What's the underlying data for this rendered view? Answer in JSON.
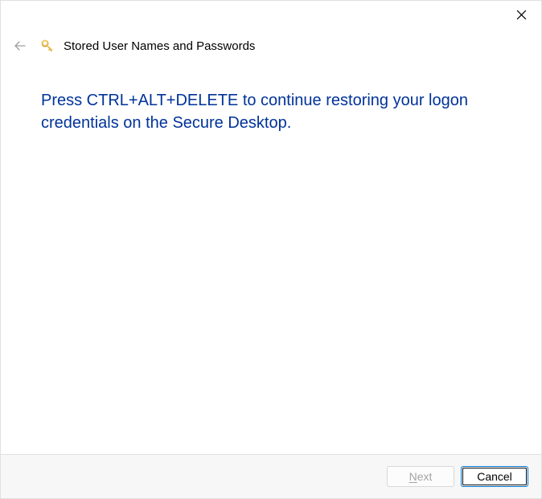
{
  "header": {
    "wizard_title": "Stored User Names and Passwords"
  },
  "content": {
    "instruction": "Press CTRL+ALT+DELETE to continue restoring your logon credentials on the Secure Desktop."
  },
  "footer": {
    "next_prefix": "N",
    "next_suffix": "ext",
    "cancel_label": "Cancel"
  }
}
